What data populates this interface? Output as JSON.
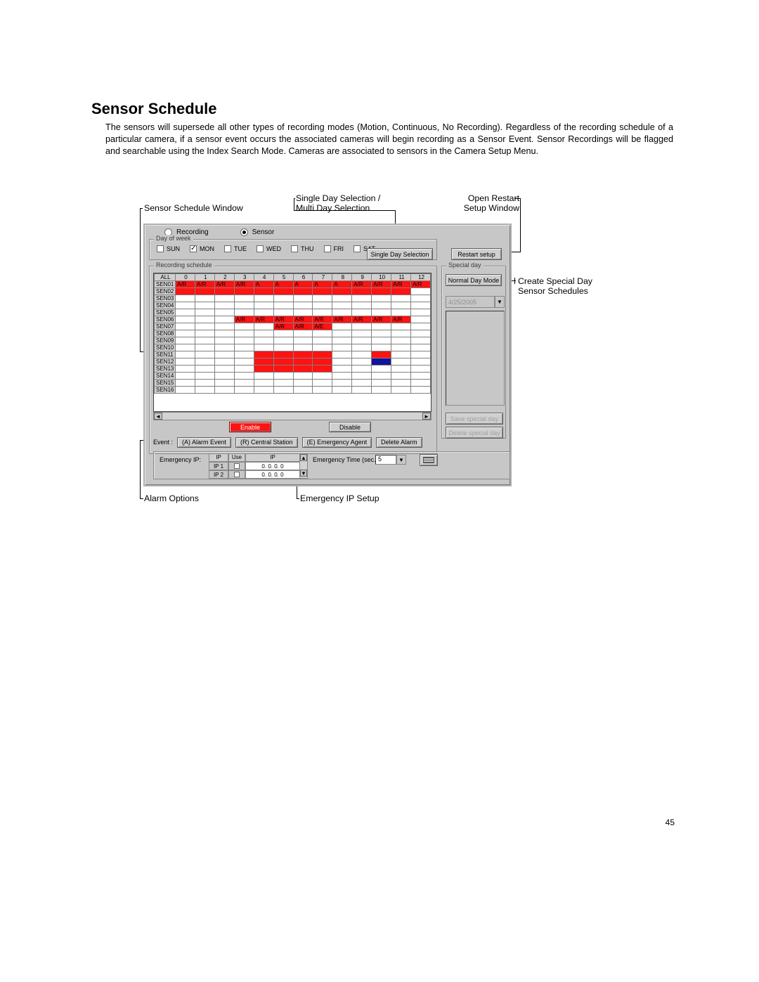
{
  "heading": "Sensor Schedule",
  "paragraph": "The sensors will supersede all other types of recording modes (Motion, Continuous, No Recording).  Regardless of the recording schedule of a particular camera, if a sensor event occurs the associated cameras will begin recording as a Sensor Event.  Sensor Recordings will be flagged and searchable using the Index Search Mode.  Cameras are associated to sensors in the Camera Setup Menu.",
  "page_number": "45",
  "callouts": {
    "sensor_window": "Sensor Schedule Window",
    "single_multi_1": "Single Day Selection /",
    "single_multi_2": "Multi Day Selection",
    "open_restart_1": "Open Restart",
    "open_restart_2": "Setup Window",
    "create_special_1": "Create Special Day",
    "create_special_2": "Sensor Schedules",
    "alarm_options": "Alarm Options",
    "emergency_ip": "Emergency IP Setup"
  },
  "dialog": {
    "radios": {
      "recording": "Recording",
      "sensor": "Sensor"
    },
    "day_of_week_legend": "Day of week",
    "days": [
      "SUN",
      "MON",
      "TUE",
      "WED",
      "THU",
      "FRI",
      "SAT"
    ],
    "day_checked": "MON",
    "single_day_btn": "Single Day Selection",
    "restart_btn": "Restart setup",
    "schedule_legend": "Recording schedule",
    "special_legend": "Special day",
    "normal_day_btn": "Normal Day Mode",
    "date_value": "4/25/2005",
    "save_special_btn": "Save special day",
    "delete_special_btn": "Delete special day",
    "enable_btn": "Enable",
    "disable_btn": "Disable",
    "event_label": "Event :",
    "event_buttons": [
      "(A) Alarm Event",
      "(R) Central Station",
      "(E) Emergency Agent",
      "Delete Alarm"
    ],
    "eip_label": "Emergency IP:",
    "eip_headers": [
      "IP",
      "Use",
      "IP"
    ],
    "eip_rows": [
      {
        "n": "IP 1",
        "use": false,
        "addr": "0. 0. 0. 0"
      },
      {
        "n": "IP 2",
        "use": false,
        "addr": "0. 0. 0. 0"
      }
    ],
    "et_label": "Emergency Time (sec.) :",
    "et_value": "5",
    "grid": {
      "col_head_first": "ALL",
      "cols": [
        "0",
        "1",
        "2",
        "3",
        "4",
        "5",
        "6",
        "7",
        "8",
        "9",
        "10",
        "11",
        "12"
      ],
      "rows": [
        {
          "name": "SEN01",
          "cells": [
            "A/R",
            "A/R",
            "A/R",
            "A/R",
            "A",
            "A",
            "A",
            "A",
            "A",
            "A/R",
            "A/R",
            "A/R",
            "A/R"
          ],
          "cls": [
            "red",
            "red",
            "red",
            "red",
            "red",
            "red",
            "red",
            "red",
            "red",
            "red",
            "red",
            "red",
            "red"
          ]
        },
        {
          "name": "SEN02",
          "cells": [
            "",
            "",
            "",
            "",
            "",
            "",
            "",
            "",
            "",
            "",
            "",
            "",
            ""
          ],
          "cls": [
            "red",
            "red",
            "red",
            "red",
            "red",
            "red",
            "red",
            "red",
            "red",
            "red",
            "red",
            "red",
            "empty"
          ]
        },
        {
          "name": "SEN03",
          "cells": [
            "",
            "",
            "",
            "",
            "",
            "",
            "",
            "",
            "",
            "",
            "",
            "",
            ""
          ],
          "cls": [
            "empty",
            "empty",
            "empty",
            "empty",
            "empty",
            "empty",
            "empty",
            "empty",
            "empty",
            "empty",
            "empty",
            "empty",
            "empty"
          ]
        },
        {
          "name": "SEN04",
          "cells": [
            "",
            "",
            "",
            "",
            "",
            "",
            "",
            "",
            "",
            "",
            "",
            "",
            ""
          ],
          "cls": [
            "empty",
            "empty",
            "empty",
            "empty",
            "empty",
            "empty",
            "empty",
            "empty",
            "empty",
            "empty",
            "empty",
            "empty",
            "empty"
          ]
        },
        {
          "name": "SEN05",
          "cells": [
            "",
            "",
            "",
            "",
            "",
            "",
            "",
            "",
            "",
            "",
            "",
            "",
            ""
          ],
          "cls": [
            "empty",
            "empty",
            "empty",
            "empty",
            "empty",
            "empty",
            "empty",
            "empty",
            "empty",
            "empty",
            "empty",
            "empty",
            "empty"
          ]
        },
        {
          "name": "SEN06",
          "cells": [
            "",
            "",
            "",
            "A/R",
            "A/R",
            "A/R",
            "A/R",
            "A/R",
            "A/R",
            "A/R",
            "A/R",
            "A/R",
            ""
          ],
          "cls": [
            "empty",
            "empty",
            "empty",
            "red",
            "red",
            "red",
            "red",
            "red",
            "red",
            "red",
            "red",
            "red",
            "empty"
          ]
        },
        {
          "name": "SEN07",
          "cells": [
            "",
            "",
            "",
            "",
            "",
            "A/R",
            "A/R",
            "A/E",
            "",
            "",
            "",
            "",
            ""
          ],
          "cls": [
            "empty",
            "empty",
            "empty",
            "empty",
            "empty",
            "red",
            "red",
            "red",
            "empty",
            "empty",
            "empty",
            "empty",
            "empty"
          ]
        },
        {
          "name": "SEN08",
          "cells": [
            "",
            "",
            "",
            "",
            "",
            "",
            "",
            "",
            "",
            "",
            "",
            "",
            ""
          ],
          "cls": [
            "empty",
            "empty",
            "empty",
            "empty",
            "empty",
            "empty",
            "empty",
            "empty",
            "empty",
            "empty",
            "empty",
            "empty",
            "empty"
          ]
        },
        {
          "name": "SEN09",
          "cells": [
            "",
            "",
            "",
            "",
            "",
            "",
            "",
            "",
            "",
            "",
            "",
            "",
            ""
          ],
          "cls": [
            "empty",
            "empty",
            "empty",
            "empty",
            "empty",
            "empty",
            "empty",
            "empty",
            "empty",
            "empty",
            "empty",
            "empty",
            "empty"
          ]
        },
        {
          "name": "SEN10",
          "cells": [
            "",
            "",
            "",
            "",
            "",
            "",
            "",
            "",
            "",
            "",
            "",
            "",
            ""
          ],
          "cls": [
            "empty",
            "empty",
            "empty",
            "empty",
            "empty",
            "empty",
            "empty",
            "empty",
            "empty",
            "empty",
            "empty",
            "empty",
            "empty"
          ]
        },
        {
          "name": "SEN11",
          "cells": [
            "",
            "",
            "",
            "",
            "",
            "",
            "",
            "",
            "",
            "",
            "",
            "",
            ""
          ],
          "cls": [
            "empty",
            "empty",
            "empty",
            "empty",
            "red",
            "red",
            "red",
            "red",
            "empty",
            "empty",
            "red",
            "empty",
            "empty"
          ]
        },
        {
          "name": "SEN12",
          "cells": [
            "",
            "",
            "",
            "",
            "",
            "",
            "",
            "",
            "",
            "",
            "",
            "",
            ""
          ],
          "cls": [
            "empty",
            "empty",
            "empty",
            "empty",
            "red",
            "red",
            "red",
            "red",
            "empty",
            "empty",
            "blue",
            "empty",
            "empty"
          ]
        },
        {
          "name": "SEN13",
          "cells": [
            "",
            "",
            "",
            "",
            "",
            "",
            "",
            "",
            "",
            "",
            "",
            "",
            ""
          ],
          "cls": [
            "empty",
            "empty",
            "empty",
            "empty",
            "red",
            "red",
            "red",
            "red",
            "empty",
            "empty",
            "empty",
            "empty",
            "empty"
          ]
        },
        {
          "name": "SEN14",
          "cells": [
            "",
            "",
            "",
            "",
            "",
            "",
            "",
            "",
            "",
            "",
            "",
            "",
            ""
          ],
          "cls": [
            "empty",
            "empty",
            "empty",
            "empty",
            "empty",
            "empty",
            "empty",
            "empty",
            "empty",
            "empty",
            "empty",
            "empty",
            "empty"
          ]
        },
        {
          "name": "SEN15",
          "cells": [
            "",
            "",
            "",
            "",
            "",
            "",
            "",
            "",
            "",
            "",
            "",
            "",
            ""
          ],
          "cls": [
            "empty",
            "empty",
            "empty",
            "empty",
            "empty",
            "empty",
            "empty",
            "empty",
            "empty",
            "empty",
            "empty",
            "empty",
            "empty"
          ]
        },
        {
          "name": "SEN16",
          "cells": [
            "",
            "",
            "",
            "",
            "",
            "",
            "",
            "",
            "",
            "",
            "",
            "",
            ""
          ],
          "cls": [
            "empty",
            "empty",
            "empty",
            "empty",
            "empty",
            "empty",
            "empty",
            "empty",
            "empty",
            "empty",
            "empty",
            "empty",
            "empty"
          ]
        }
      ]
    }
  }
}
